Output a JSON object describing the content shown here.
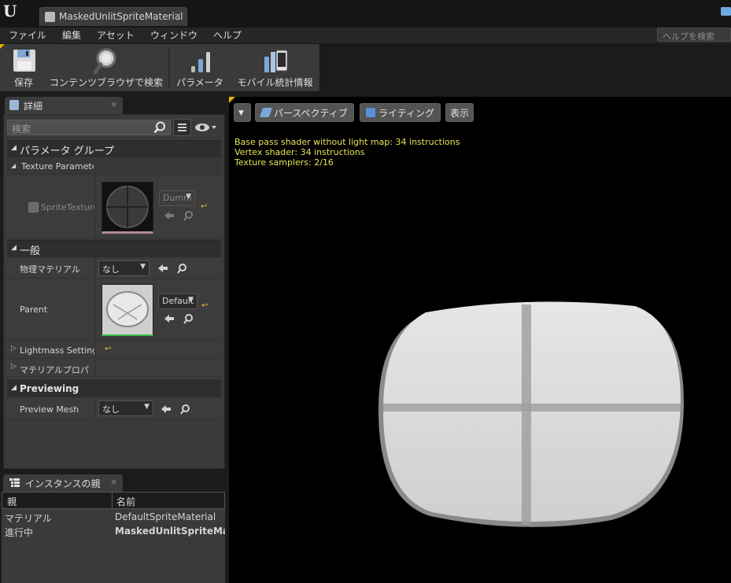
{
  "titlebar": {
    "logo": "U",
    "tab_label": "MaskedUnlitSpriteMaterial",
    "tab_close": "×"
  },
  "menu": {
    "items": [
      "ファイル",
      "編集",
      "アセット",
      "ウィンドウ",
      "ヘルプ"
    ],
    "help_search_placeholder": "ヘルプを検索"
  },
  "toolbar": {
    "buttons": [
      {
        "label": "保存",
        "icon": "save-icon"
      },
      {
        "label": "コンテンツブラウザで検索",
        "icon": "browse-icon"
      },
      {
        "label": "パラメータ",
        "icon": "parameters-icon"
      },
      {
        "label": "モバイル統計情報",
        "icon": "mobile-stats-icon"
      }
    ]
  },
  "details": {
    "tab_label": "詳細",
    "tab_close": "×",
    "search_placeholder": "検索",
    "parameter_group": {
      "title": "パラメータ グループ",
      "subgroup": "Texture Paramete",
      "sprite_texture_label": "SpriteTexture",
      "texture_combo": "Dumm"
    },
    "general": {
      "title": "一般",
      "phys_material_label": "物理マテリアル",
      "phys_material_value": "なし",
      "parent_label": "Parent",
      "parent_combo": "Default",
      "lightmass_label": "Lightmass Settings",
      "material_props_label": "マテリアルプロパ"
    },
    "previewing": {
      "title": "Previewing",
      "preview_mesh_label": "Preview Mesh",
      "preview_mesh_value": "なし"
    }
  },
  "instance_parents": {
    "tab_label": "インスタンスの親",
    "tab_close": "×",
    "columns": [
      "親",
      "名前"
    ],
    "rows": [
      {
        "parent": "マテリアル",
        "name": "DefaultSpriteMaterial"
      },
      {
        "parent": "進行中",
        "name": "MaskedUnlitSpriteMaterial"
      }
    ]
  },
  "viewport": {
    "perspective_label": "パースペクティブ",
    "lighting_label": "ライティング",
    "show_label": "表示",
    "stats": [
      "Base pass shader without light map: 34 instructions",
      "Vertex shader: 34 instructions",
      "Texture samplers: 2/16"
    ]
  },
  "colors": {
    "accent": "#e2b100",
    "stats_text": "#e4e45a",
    "panel": "#3a3a3a",
    "reset_arrow": "#e0c030"
  }
}
